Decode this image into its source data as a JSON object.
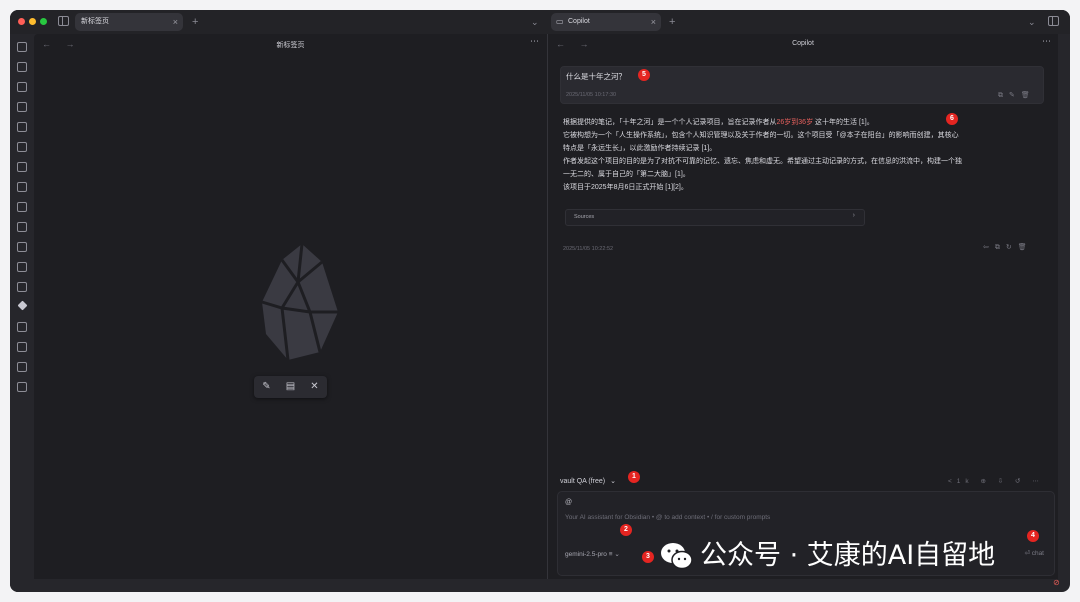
{
  "left_tab": {
    "label": "新标签页"
  },
  "right_tab": {
    "label": "Copilot"
  },
  "left_pane": {
    "title": "新标签页"
  },
  "right_pane": {
    "title": "Copilot"
  },
  "chat": {
    "question": "什么是十年之河？",
    "question_time": "2025/11/05 10:17:30",
    "answer_lines": [
      "根据提供的笔记，「十年之河」是一个个人记录项目，旨在记录作者从",
      "26岁到36岁",
      " 这十年的生活 [1]。",
      "它被构想为一个「人生操作系统」，包含个人知识管理以及关于作者的一切。这个项目受「@本子在阳台」的影响而创建，其核心",
      "特点是「永远生长」，以此激励作者持续记录 [1]。",
      "作者发起这个项目的目的是为了对抗不可靠的记忆、遗忘、焦虑和虚无。希望通过主动记录的方式，在信息的洪流中，构建一个独",
      "一无二的、属于自己的「第二大脑」[1]。",
      "该项目于2025年8月6日正式开始 [1][2]。"
    ],
    "sources_label": "Sources",
    "answer_time": "2025/11/05 10:22:52"
  },
  "mode": {
    "label": "vault QA (free)"
  },
  "input": {
    "at": "@",
    "placeholder": "Your AI assistant for Obsidian • @ to add context • / for custom prompts",
    "model": "gemini-2.5-pro",
    "send": "⏎ chat"
  },
  "context_count": "<1k",
  "badges": [
    "1",
    "2",
    "3",
    "4",
    "5",
    "6"
  ],
  "watermark": {
    "text": "公众号 · 艾康的AI自留地"
  },
  "colors": {
    "background": "#1e1e22",
    "highlight": "#e6605d",
    "badge": "#e52521"
  }
}
